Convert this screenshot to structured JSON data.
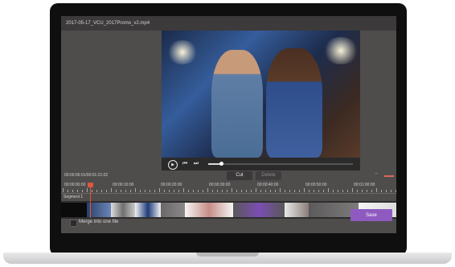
{
  "window": {
    "title": "2017-05-17_VCU_2017Promo_v2.mp4"
  },
  "player": {
    "play_icon": "play-icon",
    "prev_icon": "prev-frame-icon",
    "next_icon": "next-frame-icon",
    "play_glyph": "▶",
    "prev_glyph": "⏮",
    "next_glyph": "⏭",
    "progress": 0.09
  },
  "toolbar": {
    "timecode": "00:00:06:01/00:01:21:02",
    "cut_label": "Cut",
    "delete_label": "Delete",
    "zoom_minus": "−"
  },
  "ruler": {
    "ticks": [
      "00:00:00:00",
      "00:00:10:00",
      "00:00:20:00",
      "00:00:30:00",
      "00:00:40:00",
      "00:00:50:00",
      "00:01:00:00"
    ]
  },
  "timeline": {
    "segment_label": "Segment 1",
    "playhead_color": "#e0563e"
  },
  "footer": {
    "merge_label": "Merge into one file",
    "save_label": "Save",
    "save_color": "#8e5ac0"
  }
}
